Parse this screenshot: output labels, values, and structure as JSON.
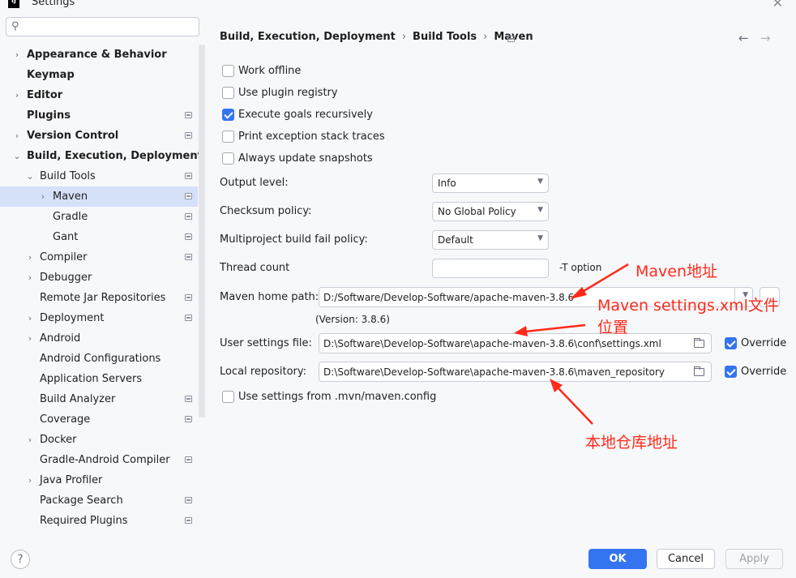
{
  "window": {
    "title": "Settings",
    "app_icon": "intellij-icon"
  },
  "search": {
    "placeholder": "",
    "value": ""
  },
  "sidebar": {
    "items": [
      {
        "label": "Appearance & Behavior",
        "bold": true,
        "level": 0,
        "chevron": "›",
        "proj": false
      },
      {
        "label": "Keymap",
        "bold": true,
        "level": 0,
        "chevron": "",
        "proj": false
      },
      {
        "label": "Editor",
        "bold": true,
        "level": 0,
        "chevron": "›",
        "proj": false
      },
      {
        "label": "Plugins",
        "bold": true,
        "level": 0,
        "chevron": "",
        "proj": true
      },
      {
        "label": "Version Control",
        "bold": true,
        "level": 0,
        "chevron": "›",
        "proj": true
      },
      {
        "label": "Build, Execution, Deployment",
        "bold": true,
        "level": 0,
        "chevron": "⌄",
        "proj": false
      },
      {
        "label": "Build Tools",
        "bold": false,
        "level": 1,
        "chevron": "⌄",
        "proj": true
      },
      {
        "label": "Maven",
        "bold": false,
        "level": 2,
        "chevron": "›",
        "proj": true,
        "selected": true
      },
      {
        "label": "Gradle",
        "bold": false,
        "level": 2,
        "chevron": "",
        "proj": true
      },
      {
        "label": "Gant",
        "bold": false,
        "level": 2,
        "chevron": "",
        "proj": true
      },
      {
        "label": "Compiler",
        "bold": false,
        "level": 1,
        "chevron": "›",
        "proj": true
      },
      {
        "label": "Debugger",
        "bold": false,
        "level": 1,
        "chevron": "›",
        "proj": false
      },
      {
        "label": "Remote Jar Repositories",
        "bold": false,
        "level": 1,
        "chevron": "",
        "proj": true
      },
      {
        "label": "Deployment",
        "bold": false,
        "level": 1,
        "chevron": "›",
        "proj": true
      },
      {
        "label": "Android",
        "bold": false,
        "level": 1,
        "chevron": "›",
        "proj": false
      },
      {
        "label": "Android Configurations",
        "bold": false,
        "level": 1,
        "chevron": "",
        "proj": false
      },
      {
        "label": "Application Servers",
        "bold": false,
        "level": 1,
        "chevron": "",
        "proj": false
      },
      {
        "label": "Build Analyzer",
        "bold": false,
        "level": 1,
        "chevron": "",
        "proj": true
      },
      {
        "label": "Coverage",
        "bold": false,
        "level": 1,
        "chevron": "",
        "proj": true
      },
      {
        "label": "Docker",
        "bold": false,
        "level": 1,
        "chevron": "›",
        "proj": false
      },
      {
        "label": "Gradle-Android Compiler",
        "bold": false,
        "level": 1,
        "chevron": "",
        "proj": true
      },
      {
        "label": "Java Profiler",
        "bold": false,
        "level": 1,
        "chevron": "›",
        "proj": false
      },
      {
        "label": "Package Search",
        "bold": false,
        "level": 1,
        "chevron": "",
        "proj": true
      },
      {
        "label": "Required Plugins",
        "bold": false,
        "level": 1,
        "chevron": "",
        "proj": true
      }
    ]
  },
  "breadcrumb": {
    "part1": "Build, Execution, Deployment",
    "part2": "Build Tools",
    "part3": "Maven",
    "sep": "›"
  },
  "nav": {
    "back": "←",
    "forward": "→"
  },
  "options": {
    "work_offline": {
      "label": "Work offline",
      "checked": false
    },
    "use_plugin_registry": {
      "label": "Use plugin registry",
      "checked": false
    },
    "execute_goals": {
      "label": "Execute goals recursively",
      "checked": true
    },
    "print_exception": {
      "label": "Print exception stack traces",
      "checked": false
    },
    "always_update": {
      "label": "Always update snapshots",
      "checked": false
    }
  },
  "form": {
    "output_level": {
      "label": "Output level:",
      "value": "Info"
    },
    "checksum_policy": {
      "label": "Checksum policy:",
      "value": "No Global Policy"
    },
    "fail_policy": {
      "label": "Multiproject build fail policy:",
      "value": "Default"
    },
    "thread_count": {
      "label": "Thread count",
      "value": "",
      "suffix": "-T option"
    },
    "maven_home": {
      "label": "Maven home path:",
      "value": "D:/Software/Develop-Software/apache-maven-3.8.6",
      "version": "(Version: 3.8.6)"
    },
    "user_settings": {
      "label": "User settings file:",
      "value": "D:\\Software\\Develop-Software\\apache-maven-3.8.6\\conf\\settings.xml",
      "override": "Override",
      "override_checked": true
    },
    "local_repo": {
      "label": "Local repository:",
      "value": "D:\\Software\\Develop-Software\\apache-maven-3.8.6\\maven_repository",
      "override": "Override",
      "override_checked": true
    },
    "use_mvn_config": {
      "label": "Use settings from .mvn/maven.config",
      "checked": false
    }
  },
  "annotations": {
    "maven_addr": "Maven地址",
    "settings_loc_1": "Maven settings.xml文件",
    "settings_loc_2": "位置",
    "local_repo_addr": "本地仓库地址"
  },
  "buttons": {
    "ok": "OK",
    "cancel": "Cancel",
    "apply": "Apply",
    "help": "?"
  },
  "colors": {
    "accent": "#3574f0",
    "annotation": "#ff2a1a",
    "selected_row": "#d5e1f9"
  }
}
